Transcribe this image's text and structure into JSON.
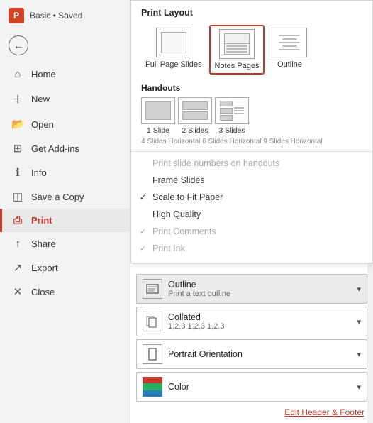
{
  "app": {
    "logo": "P",
    "title": "Basic",
    "saved": "Saved"
  },
  "sidebar": {
    "items": [
      {
        "id": "home",
        "label": "Home",
        "icon": "⌂"
      },
      {
        "id": "new",
        "label": "New",
        "icon": "+"
      },
      {
        "id": "open",
        "label": "Open",
        "icon": "📂"
      },
      {
        "id": "get-add-ins",
        "label": "Get Add-ins",
        "icon": "⊞"
      },
      {
        "id": "info",
        "label": "Info",
        "icon": "ℹ"
      },
      {
        "id": "save-a-copy",
        "label": "Save a Copy",
        "icon": "💾"
      },
      {
        "id": "print",
        "label": "Print",
        "icon": "🖨"
      },
      {
        "id": "share",
        "label": "Share",
        "icon": "↑"
      },
      {
        "id": "export",
        "label": "Export",
        "icon": "↗"
      },
      {
        "id": "close",
        "label": "Close",
        "icon": "✕"
      }
    ]
  },
  "print_layout": {
    "header": "Print Layout",
    "options": [
      {
        "id": "full-page-slides",
        "label": "Full Page Slides"
      },
      {
        "id": "notes-pages",
        "label": "Notes Pages"
      },
      {
        "id": "outline",
        "label": "Outline"
      }
    ]
  },
  "handouts": {
    "header": "Handouts",
    "options": [
      {
        "id": "1-slide",
        "label": "1 Slide",
        "cols": 1,
        "rows": 1
      },
      {
        "id": "2-slides",
        "label": "2 Slides",
        "cols": 1,
        "rows": 2
      },
      {
        "id": "3-slides",
        "label": "3 Slides",
        "cols": 1,
        "rows": 3
      }
    ],
    "more_label": "4 Slides Horizontal   6 Slides Horizontal   9 Slides Horizontal"
  },
  "menu_items": [
    {
      "id": "slide-numbers",
      "label": "Print slide numbers on handouts",
      "checked": false,
      "disabled": false
    },
    {
      "id": "frame-slides",
      "label": "Frame Slides",
      "checked": false,
      "disabled": false
    },
    {
      "id": "scale-to-fit",
      "label": "Scale to Fit Paper",
      "checked": true,
      "disabled": false
    },
    {
      "id": "high-quality",
      "label": "High Quality",
      "checked": false,
      "disabled": false
    },
    {
      "id": "print-comments",
      "label": "Print Comments",
      "checked": false,
      "disabled": true
    },
    {
      "id": "print-ink",
      "label": "Print Ink",
      "checked": false,
      "disabled": true
    }
  ],
  "bottom_dropdowns": [
    {
      "id": "outline-dropdown",
      "title": "Outline",
      "subtitle": "Print a text outline",
      "icon_type": "outline"
    },
    {
      "id": "collated-dropdown",
      "title": "Collated",
      "subtitle": "1,2,3   1,2,3   1,2,3",
      "icon_type": "collated"
    },
    {
      "id": "orientation-dropdown",
      "title": "Portrait Orientation",
      "subtitle": "",
      "icon_type": "portrait"
    },
    {
      "id": "color-dropdown",
      "title": "Color",
      "subtitle": "",
      "icon_type": "color"
    }
  ],
  "footer": {
    "link_label": "Edit Header & Footer"
  }
}
